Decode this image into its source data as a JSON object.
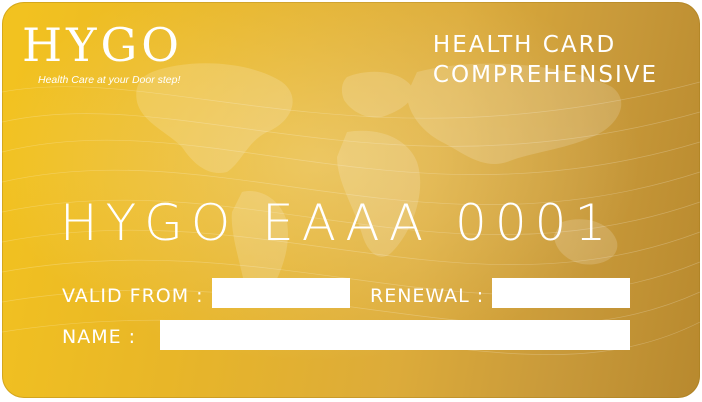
{
  "brand": {
    "logo_text": "HYGO",
    "tagline": "Health Care at your Door step!"
  },
  "card": {
    "title_line1": "HEALTH CARD",
    "title_line2": "COMPREHENSIVE",
    "number": "HYGO EAAA 0001"
  },
  "fields": {
    "valid_from_label": "VALID FROM :",
    "valid_from_value": "",
    "renewal_label": "RENEWAL :",
    "renewal_value": "",
    "name_label": "NAME :",
    "name_value": ""
  },
  "colors": {
    "gold_light": "#f3c31f",
    "gold_dark": "#b8892e",
    "text": "#ffffff"
  }
}
